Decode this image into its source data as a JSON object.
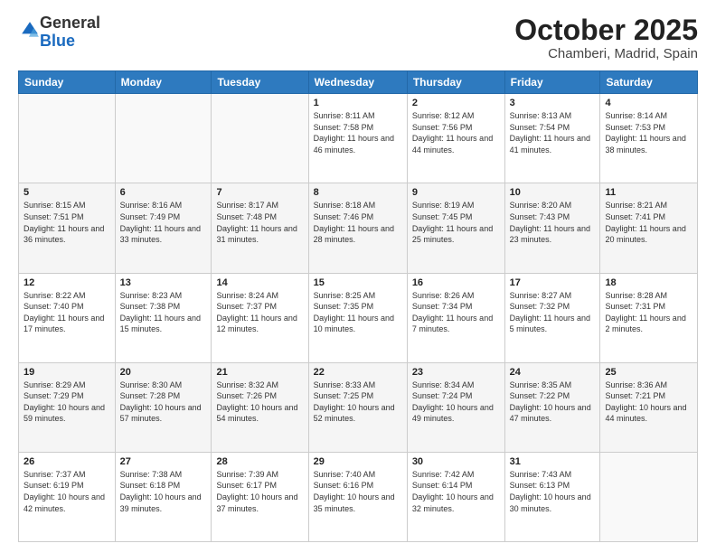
{
  "logo": {
    "general": "General",
    "blue": "Blue"
  },
  "title": "October 2025",
  "subtitle": "Chamberi, Madrid, Spain",
  "header_days": [
    "Sunday",
    "Monday",
    "Tuesday",
    "Wednesday",
    "Thursday",
    "Friday",
    "Saturday"
  ],
  "weeks": [
    [
      {
        "day": "",
        "info": ""
      },
      {
        "day": "",
        "info": ""
      },
      {
        "day": "",
        "info": ""
      },
      {
        "day": "1",
        "info": "Sunrise: 8:11 AM\nSunset: 7:58 PM\nDaylight: 11 hours and 46 minutes."
      },
      {
        "day": "2",
        "info": "Sunrise: 8:12 AM\nSunset: 7:56 PM\nDaylight: 11 hours and 44 minutes."
      },
      {
        "day": "3",
        "info": "Sunrise: 8:13 AM\nSunset: 7:54 PM\nDaylight: 11 hours and 41 minutes."
      },
      {
        "day": "4",
        "info": "Sunrise: 8:14 AM\nSunset: 7:53 PM\nDaylight: 11 hours and 38 minutes."
      }
    ],
    [
      {
        "day": "5",
        "info": "Sunrise: 8:15 AM\nSunset: 7:51 PM\nDaylight: 11 hours and 36 minutes."
      },
      {
        "day": "6",
        "info": "Sunrise: 8:16 AM\nSunset: 7:49 PM\nDaylight: 11 hours and 33 minutes."
      },
      {
        "day": "7",
        "info": "Sunrise: 8:17 AM\nSunset: 7:48 PM\nDaylight: 11 hours and 31 minutes."
      },
      {
        "day": "8",
        "info": "Sunrise: 8:18 AM\nSunset: 7:46 PM\nDaylight: 11 hours and 28 minutes."
      },
      {
        "day": "9",
        "info": "Sunrise: 8:19 AM\nSunset: 7:45 PM\nDaylight: 11 hours and 25 minutes."
      },
      {
        "day": "10",
        "info": "Sunrise: 8:20 AM\nSunset: 7:43 PM\nDaylight: 11 hours and 23 minutes."
      },
      {
        "day": "11",
        "info": "Sunrise: 8:21 AM\nSunset: 7:41 PM\nDaylight: 11 hours and 20 minutes."
      }
    ],
    [
      {
        "day": "12",
        "info": "Sunrise: 8:22 AM\nSunset: 7:40 PM\nDaylight: 11 hours and 17 minutes."
      },
      {
        "day": "13",
        "info": "Sunrise: 8:23 AM\nSunset: 7:38 PM\nDaylight: 11 hours and 15 minutes."
      },
      {
        "day": "14",
        "info": "Sunrise: 8:24 AM\nSunset: 7:37 PM\nDaylight: 11 hours and 12 minutes."
      },
      {
        "day": "15",
        "info": "Sunrise: 8:25 AM\nSunset: 7:35 PM\nDaylight: 11 hours and 10 minutes."
      },
      {
        "day": "16",
        "info": "Sunrise: 8:26 AM\nSunset: 7:34 PM\nDaylight: 11 hours and 7 minutes."
      },
      {
        "day": "17",
        "info": "Sunrise: 8:27 AM\nSunset: 7:32 PM\nDaylight: 11 hours and 5 minutes."
      },
      {
        "day": "18",
        "info": "Sunrise: 8:28 AM\nSunset: 7:31 PM\nDaylight: 11 hours and 2 minutes."
      }
    ],
    [
      {
        "day": "19",
        "info": "Sunrise: 8:29 AM\nSunset: 7:29 PM\nDaylight: 10 hours and 59 minutes."
      },
      {
        "day": "20",
        "info": "Sunrise: 8:30 AM\nSunset: 7:28 PM\nDaylight: 10 hours and 57 minutes."
      },
      {
        "day": "21",
        "info": "Sunrise: 8:32 AM\nSunset: 7:26 PM\nDaylight: 10 hours and 54 minutes."
      },
      {
        "day": "22",
        "info": "Sunrise: 8:33 AM\nSunset: 7:25 PM\nDaylight: 10 hours and 52 minutes."
      },
      {
        "day": "23",
        "info": "Sunrise: 8:34 AM\nSunset: 7:24 PM\nDaylight: 10 hours and 49 minutes."
      },
      {
        "day": "24",
        "info": "Sunrise: 8:35 AM\nSunset: 7:22 PM\nDaylight: 10 hours and 47 minutes."
      },
      {
        "day": "25",
        "info": "Sunrise: 8:36 AM\nSunset: 7:21 PM\nDaylight: 10 hours and 44 minutes."
      }
    ],
    [
      {
        "day": "26",
        "info": "Sunrise: 7:37 AM\nSunset: 6:19 PM\nDaylight: 10 hours and 42 minutes."
      },
      {
        "day": "27",
        "info": "Sunrise: 7:38 AM\nSunset: 6:18 PM\nDaylight: 10 hours and 39 minutes."
      },
      {
        "day": "28",
        "info": "Sunrise: 7:39 AM\nSunset: 6:17 PM\nDaylight: 10 hours and 37 minutes."
      },
      {
        "day": "29",
        "info": "Sunrise: 7:40 AM\nSunset: 6:16 PM\nDaylight: 10 hours and 35 minutes."
      },
      {
        "day": "30",
        "info": "Sunrise: 7:42 AM\nSunset: 6:14 PM\nDaylight: 10 hours and 32 minutes."
      },
      {
        "day": "31",
        "info": "Sunrise: 7:43 AM\nSunset: 6:13 PM\nDaylight: 10 hours and 30 minutes."
      },
      {
        "day": "",
        "info": ""
      }
    ]
  ]
}
